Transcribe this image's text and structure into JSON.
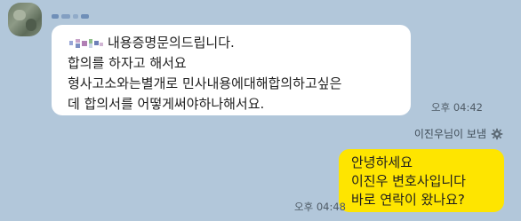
{
  "incoming": {
    "first_line_text": "내용증명문의드립니다.",
    "lines": [
      "합의를 하자고 해서요",
      "형사고소와는별개로 민사내용에대해합의하고싶은",
      "데 합의서를 어떻게써야하나해서요."
    ],
    "time": "오후 04:42"
  },
  "read_notice": {
    "text": "이진우님이 보냄",
    "icon": "settings-icon"
  },
  "outgoing": {
    "lines": [
      "안녕하세요",
      "이진우 변호사입니다",
      "바로 연락이 왔나요?"
    ],
    "time": "오후 04:48",
    "bubble_color": "#fee500"
  },
  "colors": {
    "background": "#b2c7da",
    "incoming_bubble": "#ffffff"
  }
}
